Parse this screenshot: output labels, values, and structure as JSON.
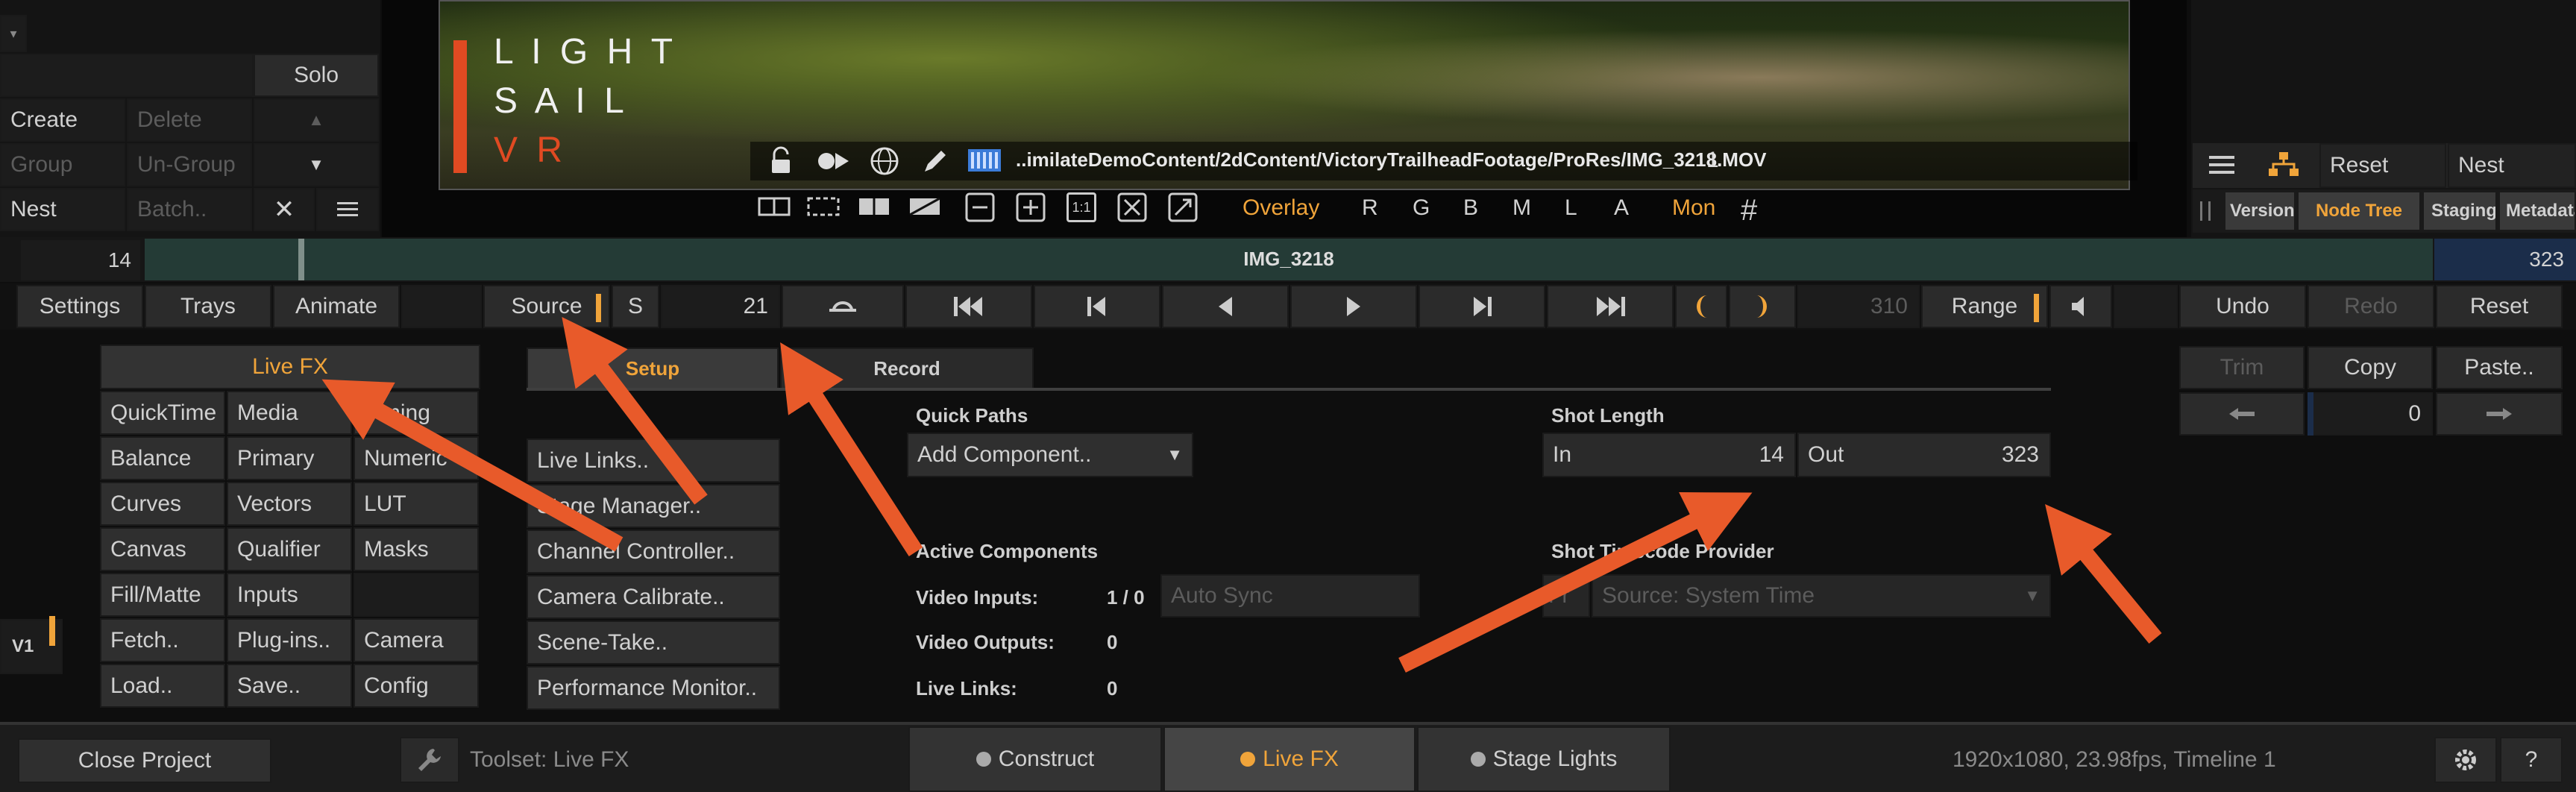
{
  "layers": {
    "solo": "Solo",
    "create": "Create",
    "delete": "Delete",
    "group": "Group",
    "ungroup": "Un-Group",
    "nest": "Nest",
    "batch": "Batch.."
  },
  "viewer": {
    "logo_line1": "L I G H T",
    "logo_line2": "S A I L",
    "logo_line3": "V R",
    "filepath": "..imilateDemoContent/2dContent/VictoryTrailheadFootage/ProRes/IMG_3218.MOV",
    "frame": "1",
    "overlay": "Overlay",
    "ch_r": "R",
    "ch_g": "G",
    "ch_b": "B",
    "ch_m": "M",
    "ch_l": "L",
    "ch_a": "A",
    "mon": "Mon",
    "one_to_one": "1:1"
  },
  "right_panel": {
    "reset": "Reset",
    "nest": "Nest",
    "tabs": [
      "Version",
      "Node Tree",
      "Staging",
      "Metadata"
    ]
  },
  "timeline": {
    "start": "14",
    "clip": "IMG_3218",
    "end": "323"
  },
  "transport": {
    "settings": "Settings",
    "trays": "Trays",
    "animate": "Animate",
    "source": "Source",
    "s": "S",
    "frame": "21",
    "end_frame": "310",
    "range": "Range",
    "undo": "Undo",
    "redo": "Redo",
    "reset": "Reset"
  },
  "toolset": {
    "header": "Live FX",
    "grid": [
      [
        "QuickTime",
        "Media",
        "Timing"
      ],
      [
        "Balance",
        "Primary",
        "Numeric"
      ],
      [
        "Curves",
        "Vectors",
        "LUT"
      ],
      [
        "Canvas",
        "Qualifier",
        "Masks"
      ],
      [
        "Fill/Matte",
        "Inputs",
        ""
      ],
      [
        "Fetch..",
        "Plug-ins..",
        "Camera"
      ],
      [
        "Load..",
        "Save..",
        "Config"
      ]
    ]
  },
  "v1": "V1",
  "setup": {
    "tab_setup": "Setup",
    "tab_record": "Record",
    "links": [
      "Live Links..",
      "Stage Manager..",
      "Channel Controller..",
      "Camera Calibrate..",
      "Scene-Take..",
      "Performance Monitor.."
    ],
    "quick_paths_label": "Quick Paths",
    "add_component": "Add Component..",
    "active_components": "Active Components",
    "video_inputs_label": "Video Inputs:",
    "video_inputs": "1 / 0",
    "auto_sync": "Auto Sync",
    "video_outputs_label": "Video Outputs:",
    "video_outputs": "0",
    "live_links_label": "Live Links:",
    "live_links": "0",
    "shot_length": "Shot Length",
    "in_label": "In",
    "in_val": "14",
    "out_label": "Out",
    "out_val": "323",
    "timecode_provider": "Shot Timecode Provider",
    "tc_source": "Source: System Time",
    "tc_prefix": "Fr"
  },
  "edit": {
    "trim": "Trim",
    "copy": "Copy",
    "paste": "Paste..",
    "nudge": "0"
  },
  "bottom": {
    "close_project": "Close Project",
    "toolset": "Toolset: Live FX",
    "construct": "Construct",
    "live_fx": "Live FX",
    "stage_lights": "Stage Lights",
    "info": "1920x1080, 23.98fps, Timeline 1",
    "help": "?"
  },
  "colors": {
    "accent": "#f0a43a",
    "arrow": "#e85a2a",
    "timeline": "#243b36",
    "logo_bar": "#e04a22"
  }
}
